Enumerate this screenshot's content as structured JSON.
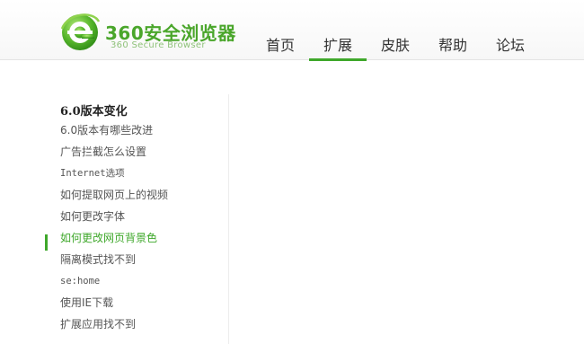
{
  "brand": {
    "title": "360安全浏览器",
    "subtitle": "360 Secure Browser",
    "logo_icon": "e-logo-icon",
    "accent_color": "#3fa82b"
  },
  "nav": {
    "items": [
      {
        "label": "首页",
        "active": false
      },
      {
        "label": "扩展",
        "active": true
      },
      {
        "label": "皮肤",
        "active": false
      },
      {
        "label": "帮助",
        "active": false
      },
      {
        "label": "论坛",
        "active": false
      }
    ]
  },
  "sidebar": {
    "title": "6.0版本变化",
    "items": [
      {
        "label": "6.0版本有哪些改进",
        "active": false
      },
      {
        "label": "广告拦截怎么设置",
        "active": false
      },
      {
        "label": "Internet选项",
        "active": false
      },
      {
        "label": "如何提取网页上的视频",
        "active": false
      },
      {
        "label": "如何更改字体",
        "active": false
      },
      {
        "label": "如何更改网页背景色",
        "active": true
      },
      {
        "label": "隔离模式找不到",
        "active": false
      },
      {
        "label": "se:home",
        "active": false
      },
      {
        "label": "使用IE下载",
        "active": false
      },
      {
        "label": "扩展应用找不到",
        "active": false
      }
    ]
  }
}
